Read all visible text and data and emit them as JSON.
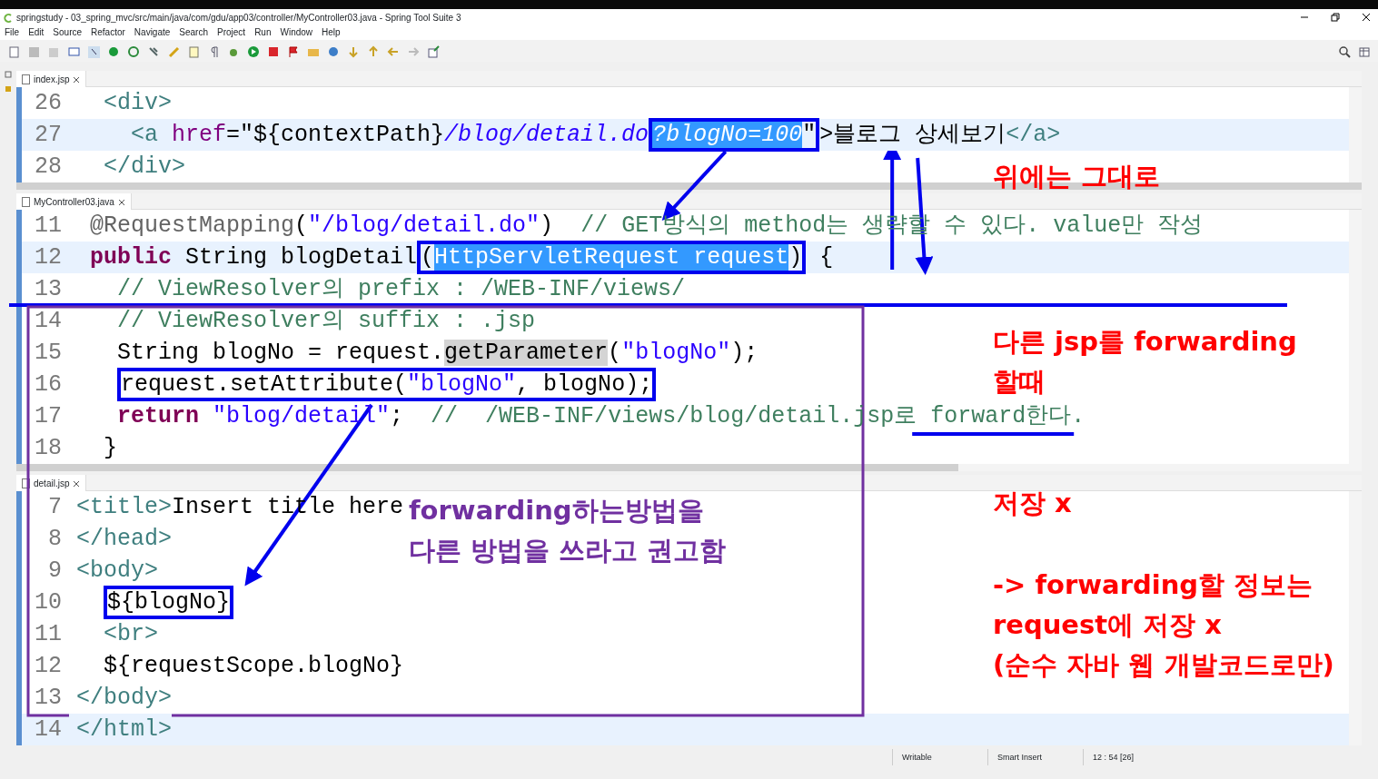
{
  "window": {
    "title": "springstudy - 03_spring_mvc/src/main/java/com/gdu/app03/controller/MyController03.java - Spring Tool Suite 3"
  },
  "menu": [
    "File",
    "Edit",
    "Source",
    "Refactor",
    "Navigate",
    "Search",
    "Project",
    "Run",
    "Window",
    "Help"
  ],
  "editors": [
    {
      "tab": "index.jsp",
      "lines": [
        {
          "number": "26",
          "current": false,
          "segments": [
            {
              "text": "  <div>",
              "kind": "tag"
            }
          ]
        },
        {
          "number": "27",
          "current": true,
          "segments": [
            {
              "text": "    <a",
              "kind": "tag"
            },
            {
              "text": " href",
              "kind": "attr"
            },
            {
              "text": "=\"${contextPath}",
              "kind": "plain"
            },
            {
              "text": "/blog/detail.do",
              "kind": "italic"
            },
            {
              "boxed": true,
              "parts": [
                {
                  "text": "?blogNo=100",
                  "kind": "italic",
                  "selected": true
                },
                {
                  "text": "\"",
                  "kind": "plain"
                }
              ]
            },
            {
              "text": ">블로그 상세보기",
              "kind": "plain"
            },
            {
              "text": "</a>",
              "kind": "tag"
            }
          ]
        },
        {
          "number": "28",
          "current": false,
          "segments": [
            {
              "text": "  </div>",
              "kind": "tag"
            }
          ]
        }
      ]
    },
    {
      "tab": "MyController03.java",
      "lines": [
        {
          "number": "11",
          "current": false,
          "segments": [
            {
              "text": " @RequestMapping",
              "kind": "annotation"
            },
            {
              "text": "(",
              "kind": "plain"
            },
            {
              "text": "\"/blog/detail.do\"",
              "kind": "string"
            },
            {
              "text": ")  ",
              "kind": "plain"
            },
            {
              "text": "// GET방식의 method는 생략할 수 있다. value만 작성",
              "kind": "comment"
            }
          ]
        },
        {
          "number": "12",
          "current": true,
          "segments": [
            {
              "text": " public",
              "kind": "keyword"
            },
            {
              "text": " String blogDetail",
              "kind": "plain"
            },
            {
              "boxed": true,
              "parts": [
                {
                  "text": "(",
                  "kind": "plain"
                },
                {
                  "text": "HttpServletRequest request",
                  "kind": "plain",
                  "selected": true
                },
                {
                  "text": ")",
                  "kind": "plain"
                }
              ]
            },
            {
              "text": " {",
              "kind": "plain"
            }
          ]
        },
        {
          "number": "13",
          "current": false,
          "segments": [
            {
              "text": "   // ViewResolver의 prefix : /WEB-INF/views/",
              "kind": "comment"
            }
          ]
        },
        {
          "number": "14",
          "current": false,
          "segments": [
            {
              "text": "   // ViewResolver의 suffix : .jsp",
              "kind": "comment"
            }
          ]
        },
        {
          "number": "15",
          "current": false,
          "segments": [
            {
              "text": "   String blogNo = request.",
              "kind": "plain"
            },
            {
              "text": "getParameter",
              "kind": "plain",
              "occurrence": true
            },
            {
              "text": "(",
              "kind": "plain"
            },
            {
              "text": "\"blogNo\"",
              "kind": "string"
            },
            {
              "text": ");",
              "kind": "plain"
            }
          ]
        },
        {
          "number": "16",
          "current": false,
          "segments": [
            {
              "boxed": true,
              "parts": [
                {
                  "text": "   request.setAttribute(",
                  "kind": "plain"
                },
                {
                  "text": "\"blogNo\"",
                  "kind": "string"
                },
                {
                  "text": ", blogNo);",
                  "kind": "plain"
                }
              ]
            }
          ]
        },
        {
          "number": "17",
          "current": false,
          "segments": [
            {
              "text": "   return",
              "kind": "keyword"
            },
            {
              "text": " \"blog/detail\"",
              "kind": "string"
            },
            {
              "text": ";  ",
              "kind": "plain"
            },
            {
              "text": "//  /WEB-INF/views/blog/detail.jsp로 forward한다.",
              "kind": "comment"
            }
          ]
        },
        {
          "number": "18",
          "current": false,
          "segments": [
            {
              "text": "  }",
              "kind": "plain"
            }
          ]
        }
      ]
    },
    {
      "tab": "detail.jsp",
      "lines": [
        {
          "number": "7",
          "current": false,
          "segments": [
            {
              "text": "<title>",
              "kind": "tag"
            },
            {
              "text": "Insert title here",
              "kind": "plain"
            }
          ]
        },
        {
          "number": "8",
          "current": false,
          "segments": [
            {
              "text": "</head>",
              "kind": "tag"
            }
          ]
        },
        {
          "number": "9",
          "current": false,
          "segments": [
            {
              "text": "<body>",
              "kind": "tag"
            }
          ]
        },
        {
          "number": "10",
          "current": false,
          "segments": [
            {
              "boxed": true,
              "parts": [
                {
                  "text": "  ${blogNo}",
                  "kind": "plain"
                }
              ]
            }
          ]
        },
        {
          "number": "11",
          "current": false,
          "segments": [
            {
              "text": "  <br>",
              "kind": "tag"
            }
          ]
        },
        {
          "number": "12",
          "current": false,
          "segments": [
            {
              "text": "  ${requestScope.blogNo}",
              "kind": "plain"
            }
          ]
        },
        {
          "number": "13",
          "current": false,
          "segments": [
            {
              "text": "</body>",
              "kind": "tag"
            }
          ]
        },
        {
          "number": "14",
          "current": true,
          "segments": [
            {
              "text": "</html>",
              "kind": "tag"
            }
          ]
        }
      ]
    }
  ],
  "notes": [
    {
      "lines": [
        "위에는 그대로"
      ],
      "color": "#ff0000"
    },
    {
      "lines": [
        "다른 jsp를 forwarding",
        "할때"
      ],
      "color": "#ff0000"
    },
    {
      "lines": [
        "forwarding하는방법을",
        "다른 방법을 쓰라고 권고함"
      ],
      "color": "#7030a0"
    },
    {
      "lines": [
        "저장 x"
      ],
      "color": "#ff0000"
    },
    {
      "lines": [
        "-> forwarding할 정보는",
        "request에 저장 x",
        "(순수 자바 웹 개발코드로만)"
      ],
      "color": "#ff0000"
    }
  ],
  "status_bar": [
    "Writable",
    "Smart Insert",
    "12 : 54 [26]"
  ]
}
